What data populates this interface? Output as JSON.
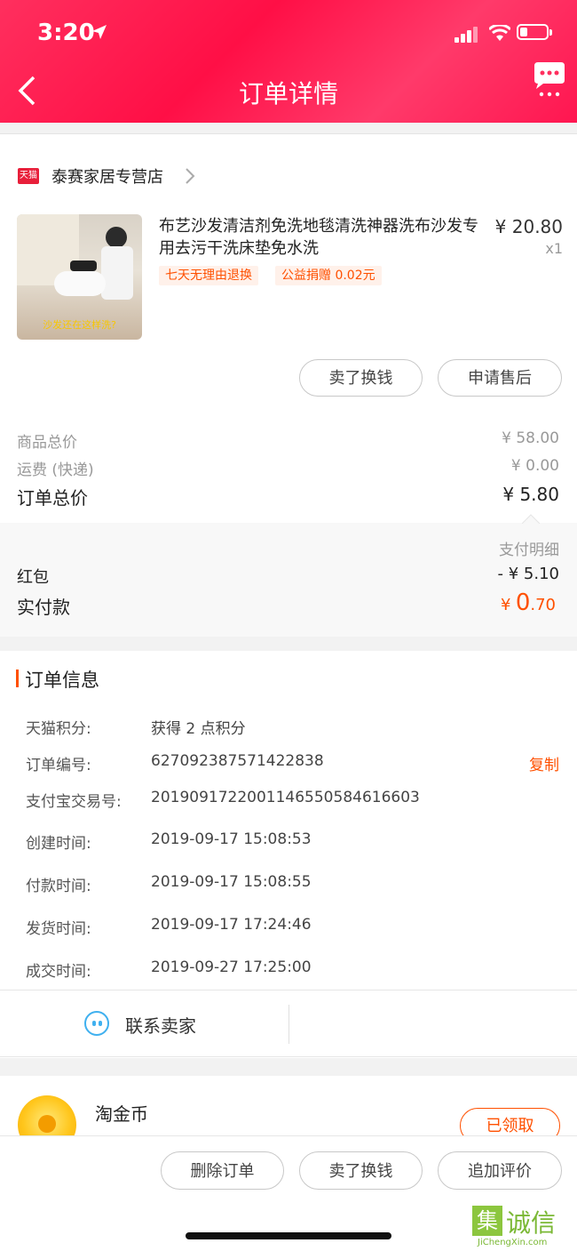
{
  "status_bar": {
    "time": "3:20"
  },
  "header": {
    "title": "订单详情"
  },
  "store": {
    "badge": "天猫",
    "name": "泰赛家居专营店"
  },
  "product": {
    "title": "布艺沙发清洁剂免洗地毯清洗神器洗布沙发专用去污干洗床垫免水洗",
    "price": "¥ 20.80",
    "qty": "x1",
    "tags": [
      "七天无理由退换",
      "公益捐赠 0.02元"
    ],
    "image_caption": "沙发还在这样洗?"
  },
  "actions": {
    "sell_label": "卖了换钱",
    "after_sale_label": "申请售后"
  },
  "summary": {
    "goods_total_label": "商品总价",
    "goods_total_value": "¥ 58.00",
    "shipping_label": "运费 (快递)",
    "shipping_value": "¥ 0.00",
    "order_total_label": "订单总价",
    "order_total_value": "¥ 5.80"
  },
  "payment": {
    "detail_label": "支付明细",
    "red_packet_label": "红包",
    "red_packet_value": "- ¥ 5.10",
    "paid_label": "实付款",
    "paid_currency": "¥",
    "paid_integer": "0",
    "paid_decimal": ".70"
  },
  "order_info": {
    "section_title": "订单信息",
    "rows": [
      {
        "label": "天猫积分:",
        "value": "获得 2 点积分"
      },
      {
        "label": "订单编号:",
        "value": "627092387571422838"
      },
      {
        "label": "支付宝交易号:",
        "value": "2019091722001146550584616603"
      },
      {
        "label": "创建时间:",
        "value": "2019-09-17 15:08:53"
      },
      {
        "label": "付款时间:",
        "value": "2019-09-17 15:08:55"
      },
      {
        "label": "发货时间:",
        "value": "2019-09-17 17:24:46"
      },
      {
        "label": "成交时间:",
        "value": "2019-09-27 17:25:00"
      }
    ],
    "copy_label": "复制"
  },
  "contact": {
    "label": "联系卖家"
  },
  "coins": {
    "label": "淘金币",
    "claimed_label": "已领取"
  },
  "bottom_actions": {
    "delete_label": "删除订单",
    "sell_label": "卖了换钱",
    "review_label": "追加评价"
  },
  "watermark": {
    "glyph": "集",
    "text": "诚信",
    "sub": "JiChengXin.com"
  },
  "colors": {
    "header_red": "#ff1f4f",
    "accent_orange": "#ff5000"
  }
}
